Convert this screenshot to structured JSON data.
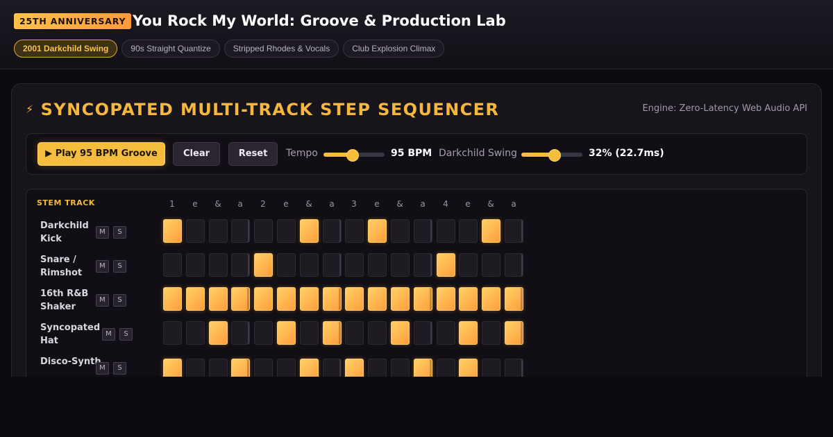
{
  "header": {
    "badge": "25TH ANNIVERSARY",
    "title": "You Rock My World: Groove & Production Lab",
    "presets": [
      {
        "label": "2001 Darkchild Swing",
        "active": true
      },
      {
        "label": "90s Straight Quantize",
        "active": false
      },
      {
        "label": "Stripped Rhodes & Vocals",
        "active": false
      },
      {
        "label": "Club Explosion Climax",
        "active": false
      }
    ]
  },
  "sequencer": {
    "title": "SYNCOPATED MULTI-TRACK STEP SEQUENCER",
    "bolt_icon": "⚡",
    "engine": "Engine: Zero-Latency Web Audio API",
    "controls": {
      "play_icon": "▶",
      "play_label": "Play 95 BPM Groove",
      "clear_label": "Clear",
      "reset_label": "Reset",
      "tempo_label": "Tempo",
      "tempo_value": "95 BPM",
      "tempo_position": 0.47,
      "swing_label": "Darkchild Swing",
      "swing_value": "32% (22.7ms)",
      "swing_position": 0.53
    },
    "grid": {
      "stem_header": "STEM TRACK",
      "beat_labels": [
        "1",
        "e",
        "&",
        "a",
        "2",
        "e",
        "&",
        "a",
        "3",
        "e",
        "&",
        "a",
        "4",
        "e",
        "&",
        "a"
      ],
      "mute_label": "M",
      "solo_label": "S",
      "tracks": [
        {
          "name": "Darkchild Kick",
          "steps": [
            1,
            0,
            0,
            0,
            0,
            0,
            1,
            0,
            0,
            1,
            0,
            0,
            0,
            0,
            1,
            0
          ]
        },
        {
          "name": "Snare / Rimshot",
          "steps": [
            0,
            0,
            0,
            0,
            1,
            0,
            0,
            0,
            0,
            0,
            0,
            0,
            1,
            0,
            0,
            0
          ]
        },
        {
          "name": "16th R&B Shaker",
          "steps": [
            1,
            1,
            1,
            1,
            1,
            1,
            1,
            1,
            1,
            1,
            1,
            1,
            1,
            1,
            1,
            1
          ]
        },
        {
          "name": "Syncopated Hat",
          "steps": [
            0,
            0,
            1,
            0,
            0,
            1,
            0,
            1,
            0,
            0,
            1,
            0,
            0,
            1,
            0,
            1
          ]
        },
        {
          "name": "Disco-Synth",
          "steps": [
            1,
            0,
            0,
            1,
            0,
            0,
            1,
            0,
            1,
            0,
            0,
            1,
            0,
            1,
            0,
            0
          ]
        }
      ]
    }
  },
  "colors": {
    "accent": "#f4bd3d",
    "badge_gradient_start": "#ffc24b",
    "step_on": "#ffb94f",
    "step_off": "#1e1b23"
  }
}
